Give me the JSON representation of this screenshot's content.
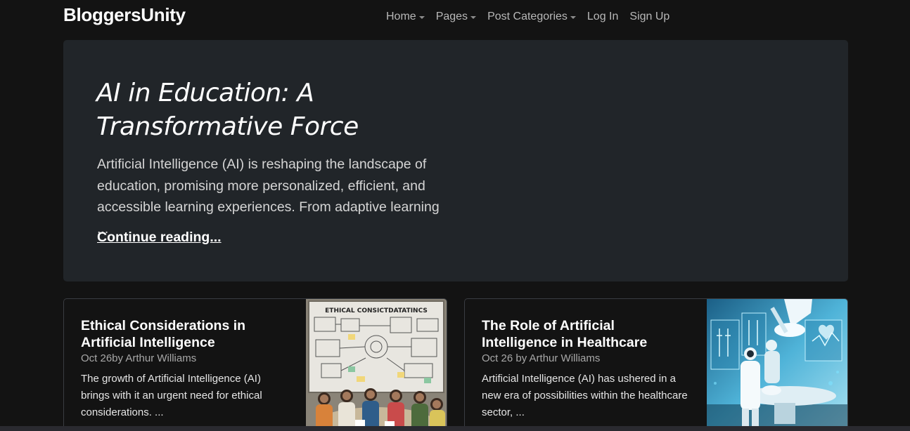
{
  "site": {
    "brand": "BloggersUnity"
  },
  "nav": {
    "items": [
      {
        "label": "Home",
        "dropdown": true
      },
      {
        "label": "Pages",
        "dropdown": true
      },
      {
        "label": "Post Categories",
        "dropdown": true
      },
      {
        "label": "Log In",
        "dropdown": false
      },
      {
        "label": "Sign Up",
        "dropdown": false
      }
    ]
  },
  "hero": {
    "title_line1": "AI in Education: A",
    "title_line2": "Transformative Force",
    "excerpt": "Artificial Intelligence (AI) is reshaping the landscape of education, promising more personalized, efficient, and accessible learning experiences. From adaptive learning ...",
    "link_label": "Continue reading..."
  },
  "cards": [
    {
      "title": "Ethical Considerations in Artificial Intelligence",
      "meta": "Oct 26by Arthur Williams",
      "excerpt": "The growth of Artificial Intelligence (AI) brings with it an urgent need for ethical considerations. ...",
      "image_text": "ETHICAL  CONSICTDATATINCS"
    },
    {
      "title": "The Role of Artificial Intelligence in Healthcare",
      "meta": "Oct 26 by Arthur Williams",
      "excerpt": "Artificial Intelligence (AI) has ushered in a new era of possibilities within the healthcare sector, ..."
    }
  ],
  "colors": {
    "background": "#131313",
    "hero_bg": "#212529",
    "card_border": "#3a3d42",
    "nav_text": "#b8b8b8"
  }
}
